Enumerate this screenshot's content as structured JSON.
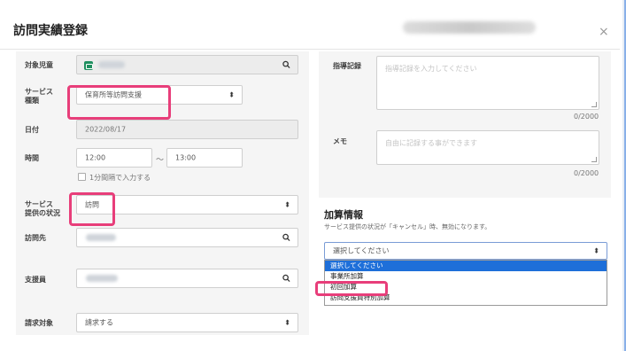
{
  "dialog": {
    "title": "訪問実績登録",
    "close_glyph": "×"
  },
  "form": {
    "child": {
      "label": "対象児童"
    },
    "service_type": {
      "label_line1": "サービス",
      "label_line2": "種類",
      "value": "保育所等訪問支援"
    },
    "date": {
      "label": "日付",
      "value": "2022/08/17"
    },
    "time": {
      "label": "時間",
      "start": "12:00",
      "separator": "〜",
      "end": "13:00",
      "checkbox_label": "1分間隔で入力する"
    },
    "service_status": {
      "label_line1": "サービス",
      "label_line2": "提供の状況",
      "value": "訪問"
    },
    "destination": {
      "label": "訪問先"
    },
    "staff": {
      "label": "支援員"
    },
    "billing": {
      "label": "請求対象",
      "value": "請求する"
    }
  },
  "right": {
    "record": {
      "label": "指導記録",
      "placeholder": "指導記録を入力してください",
      "counter": "0/2000"
    },
    "memo": {
      "label": "メモ",
      "placeholder": "自由に記録する事ができます",
      "counter": "0/2000"
    }
  },
  "addition": {
    "title": "加算情報",
    "note": "サービス提供の状況が「キャンセル」時、無効になります。",
    "select_value": "選択してください",
    "options": [
      "選択してください",
      "事業所加算",
      "初回加算",
      "訪問支援員特別加算"
    ],
    "selected_index": 0
  },
  "icons": {
    "search": "search-icon",
    "updown": "select-updown-icon",
    "close": "close-icon",
    "child_badge": "child-badge-icon"
  },
  "colors": {
    "highlight": "#e83e7a",
    "selected_option": "#1e6fd9",
    "panel_bg": "#f5f5f5"
  }
}
